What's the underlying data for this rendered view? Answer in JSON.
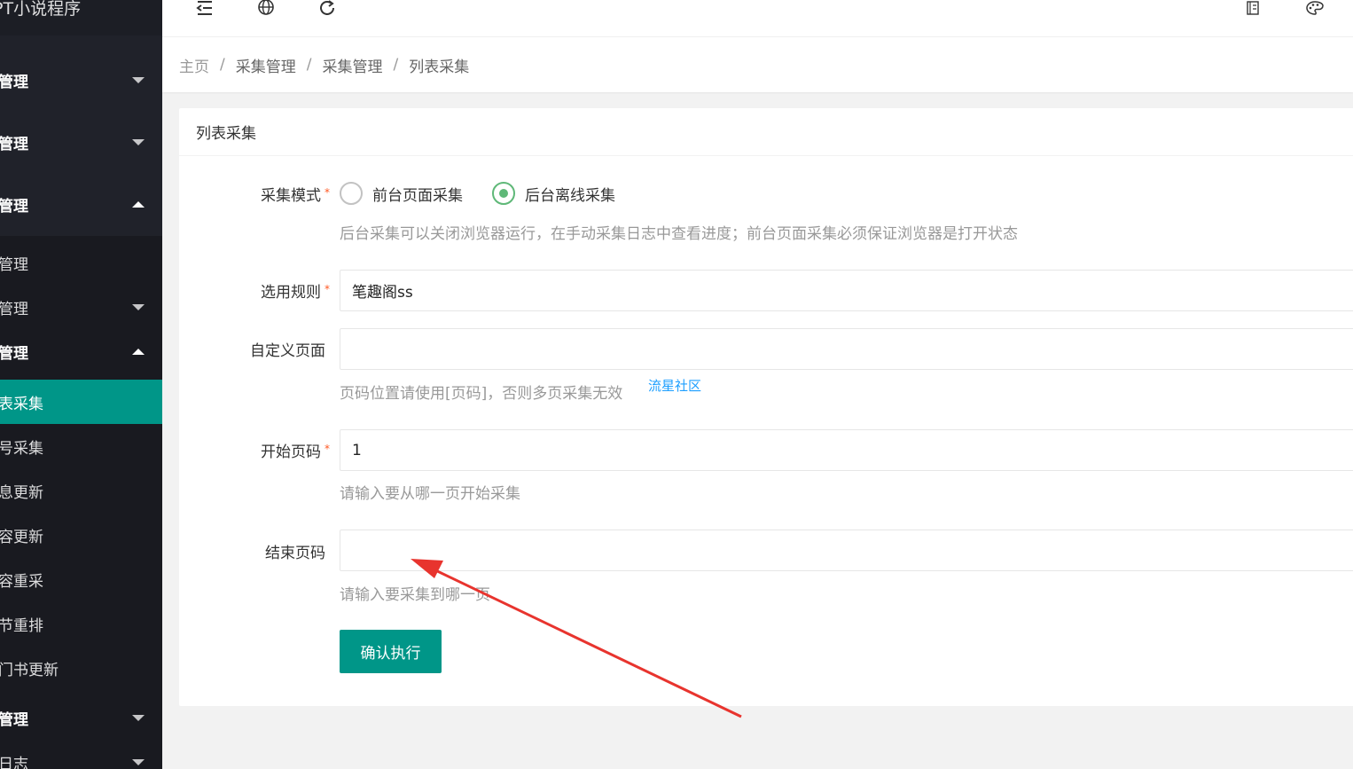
{
  "app": {
    "title": "PT小说程序"
  },
  "sidebar": {
    "items": [
      {
        "label": "管理",
        "state": "collapsed"
      },
      {
        "label": "管理",
        "state": "collapsed"
      },
      {
        "label": "管理",
        "state": "expanded"
      },
      {
        "label": "管理",
        "state": "leaf"
      },
      {
        "label": "管理",
        "state": "collapsed"
      },
      {
        "label": "管理",
        "state": "expanded"
      },
      {
        "label": "表采集",
        "state": "active"
      },
      {
        "label": "号采集",
        "state": "leaf"
      },
      {
        "label": "息更新",
        "state": "leaf"
      },
      {
        "label": "容更新",
        "state": "leaf"
      },
      {
        "label": "容重采",
        "state": "leaf"
      },
      {
        "label": "节重排",
        "state": "leaf"
      },
      {
        "label": "门书更新",
        "state": "leaf"
      },
      {
        "label": "管理",
        "state": "collapsed"
      },
      {
        "label": "日志",
        "state": "collapsed"
      }
    ]
  },
  "header": {
    "icons": [
      "menu-fold-icon",
      "globe-icon",
      "refresh-icon",
      "note-icon",
      "theme-palette-icon"
    ]
  },
  "breadcrumb": [
    "主页",
    "采集管理",
    "采集管理",
    "列表采集"
  ],
  "card": {
    "title": "列表采集",
    "mode": {
      "label": "采集模式",
      "options": [
        "前台页面采集",
        "后台离线采集"
      ],
      "selected": "后台离线采集",
      "hint": "后台采集可以关闭浏览器运行，在手动采集日志中查看进度；前台页面采集必须保证浏览器是打开状态"
    },
    "rule": {
      "label": "选用规则",
      "value": "笔趣阁ss"
    },
    "custom_page": {
      "label": "自定义页面",
      "value": "",
      "hint": "页码位置请使用[页码]，否则多页采集无效"
    },
    "start_page": {
      "label": "开始页码",
      "value": "1",
      "hint": "请输入要从哪一页开始采集"
    },
    "end_page": {
      "label": "结束页码",
      "value": "",
      "hint": "请输入要采集到哪一页"
    },
    "submit_label": "确认执行",
    "watermark_link": "流星社区"
  },
  "colors": {
    "accent": "#009688",
    "sidebar": "#20222a",
    "radio_on": "#5fb878",
    "required": "#ff5722",
    "annotation_arrow": "#e8342e"
  }
}
